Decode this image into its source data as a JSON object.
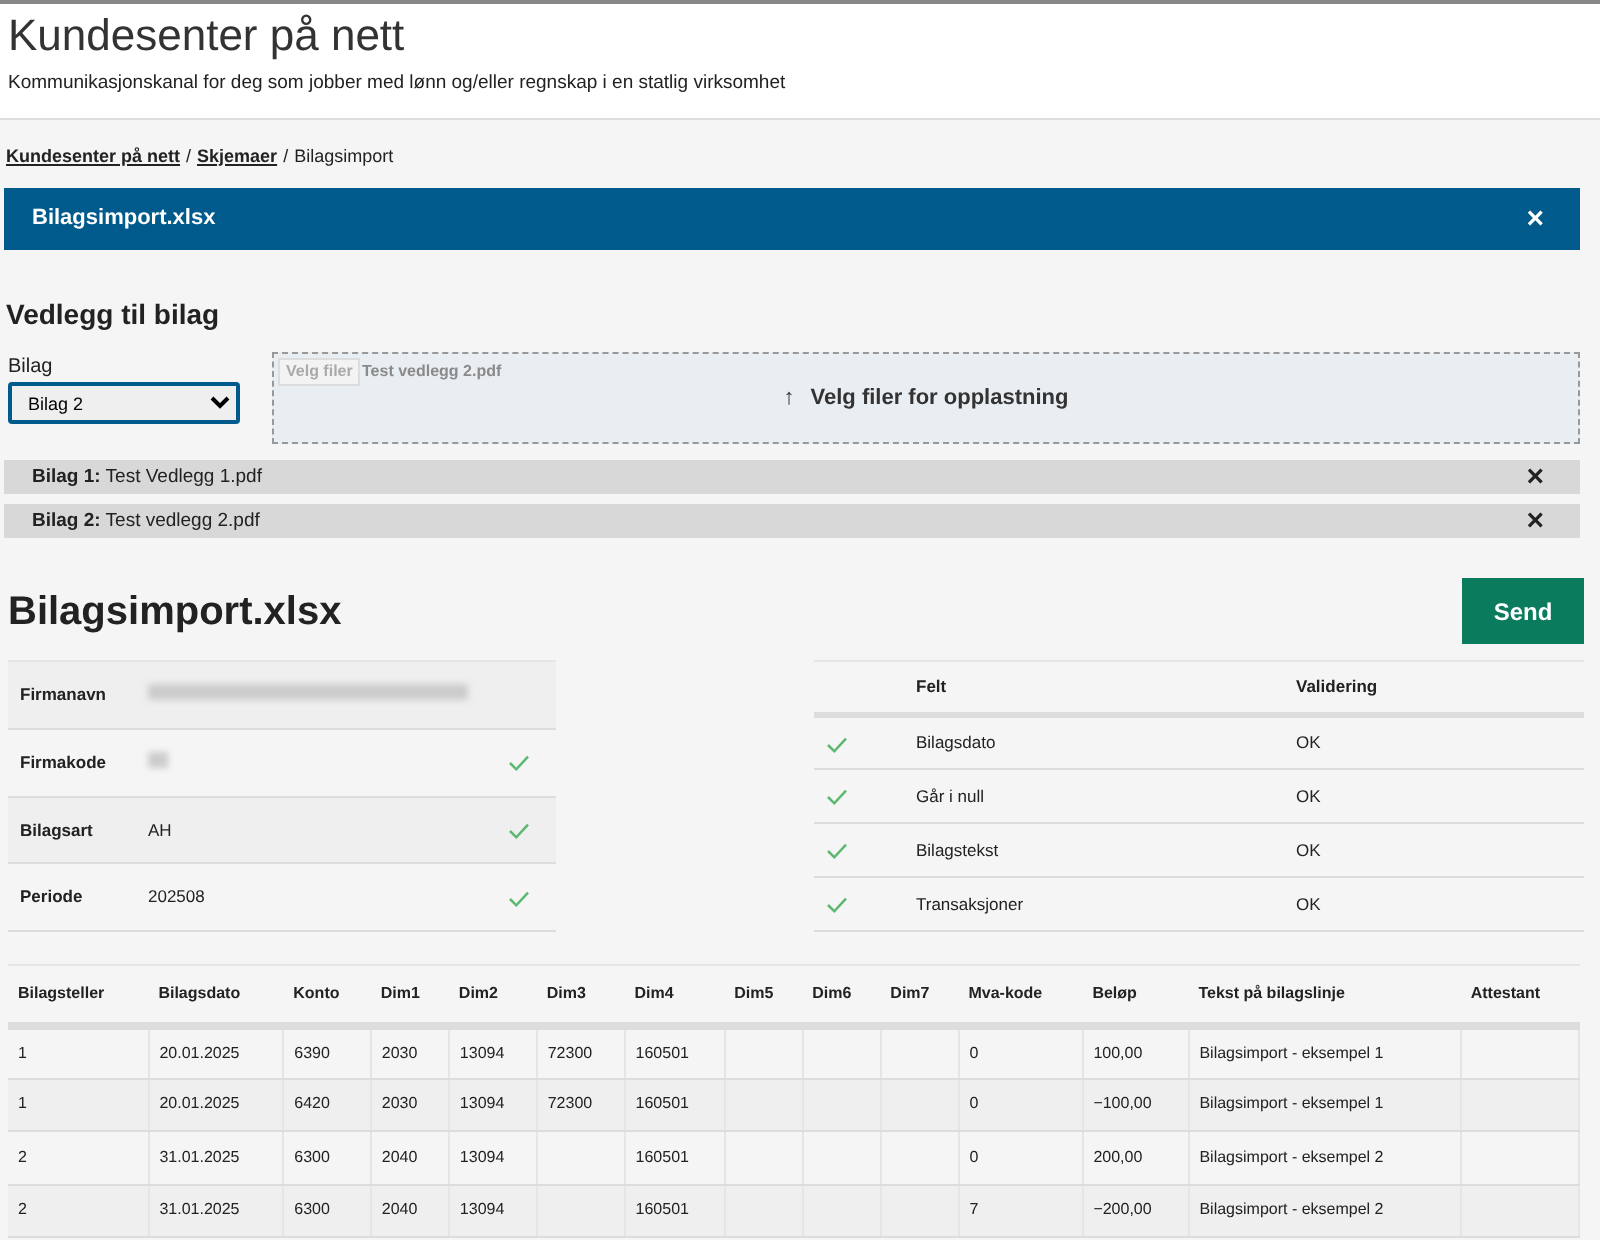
{
  "header": {
    "title": "Kundesenter på nett",
    "subtitle": "Kommunikasjonskanal for deg som jobber med lønn og/eller regnskap i en statlig virksomhet"
  },
  "breadcrumb": [
    {
      "label": "Kundesenter på nett",
      "link": true
    },
    {
      "separator": "/",
      "label": "Skjemaer",
      "link": true
    },
    {
      "separator": "/",
      "label": "Bilagsimport",
      "link": false
    }
  ],
  "file_banner": {
    "title": "Bilagsimport.xlsx",
    "close": "×"
  },
  "attachments": {
    "heading": "Vedlegg til bilag",
    "select_label": "Bilag",
    "select_value": "Bilag 2",
    "file_button": "Velg filer",
    "file_name": "Test vedlegg 2.pdf",
    "upload_label": "Velg filer for opplastning",
    "upload_icon": "↑",
    "items": [
      {
        "label": "Bilag 1:",
        "file": "Test Vedlegg 1.pdf",
        "close": "×"
      },
      {
        "label": "Bilag 2:",
        "file": "Test vedlegg 2.pdf",
        "close": "×"
      }
    ]
  },
  "import": {
    "title": "Bilagsimport.xlsx",
    "send_button": "Send"
  },
  "info": [
    {
      "label": "Firmanavn",
      "redacted": true,
      "valid": false
    },
    {
      "label": "Firmakode",
      "redacted": true,
      "valid": true
    },
    {
      "label": "Bilagsart",
      "value": "AH",
      "valid": true
    },
    {
      "label": "Periode",
      "value": "202508",
      "valid": true
    }
  ],
  "validation": {
    "columns": [
      "Felt",
      "Validering"
    ],
    "rows": [
      {
        "valid": true,
        "field": "Bilagsdato",
        "result": "OK"
      },
      {
        "valid": true,
        "field": "Går i null",
        "result": "OK"
      },
      {
        "valid": true,
        "field": "Bilagstekst",
        "result": "OK"
      },
      {
        "valid": true,
        "field": "Transaksjoner",
        "result": "OK"
      }
    ]
  },
  "lines": {
    "columns": [
      "Bilagsteller",
      "Bilagsdato",
      "Konto",
      "Dim1",
      "Dim2",
      "Dim3",
      "Dim4",
      "Dim5",
      "Dim6",
      "Dim7",
      "Mva-kode",
      "Beløp",
      "Tekst på bilagslinje",
      "Attestant"
    ],
    "rows": [
      [
        "1",
        "20.01.2025",
        "6390",
        "2030",
        "13094",
        "72300",
        "160501",
        "",
        "",
        "",
        "0",
        "100,00",
        "Bilagsimport - eksempel 1",
        ""
      ],
      [
        "1",
        "20.01.2025",
        "6420",
        "2030",
        "13094",
        "72300",
        "160501",
        "",
        "",
        "",
        "0",
        "−100,00",
        "Bilagsimport - eksempel 1",
        ""
      ],
      [
        "2",
        "31.01.2025",
        "6300",
        "2040",
        "13094",
        "",
        "160501",
        "",
        "",
        "",
        "0",
        "200,00",
        "Bilagsimport - eksempel 2",
        ""
      ],
      [
        "2",
        "31.01.2025",
        "6300",
        "2040",
        "13094",
        "",
        "160501",
        "",
        "",
        "",
        "7",
        "−200,00",
        "Bilagsimport - eksempel 2",
        ""
      ]
    ]
  }
}
